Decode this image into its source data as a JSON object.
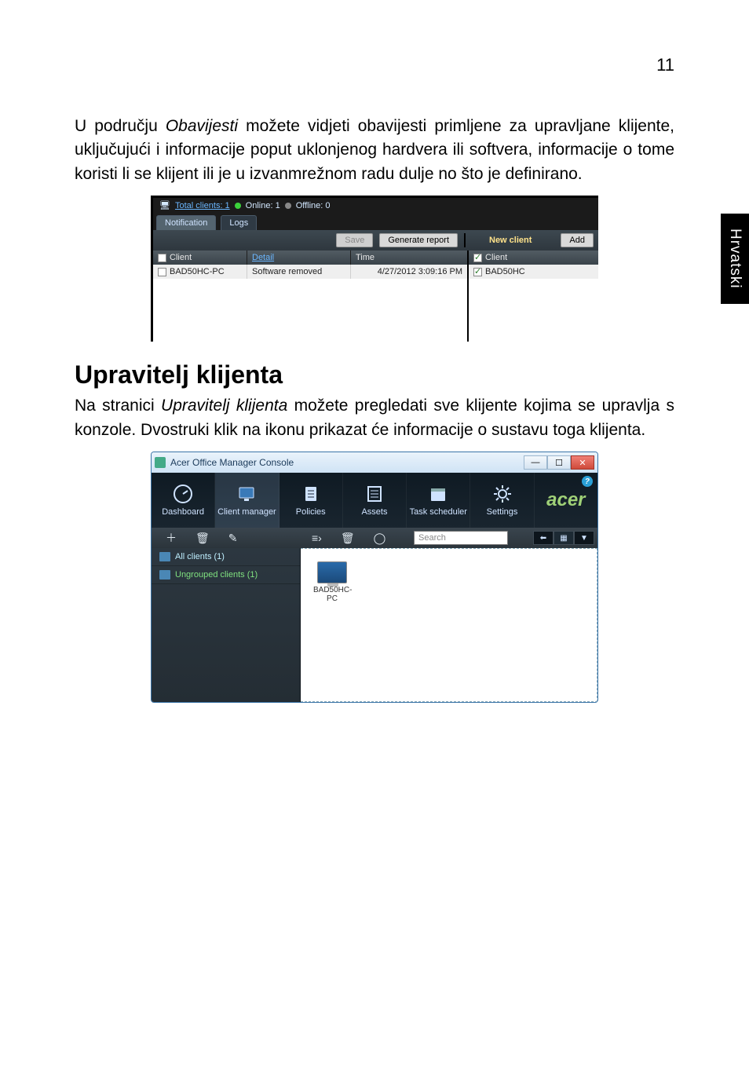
{
  "page_number": "11",
  "side_tab": "Hrvatski",
  "para1_before_italic": "U području ",
  "para1_italic": "Obavijesti",
  "para1_after_italic": " možete vidjeti obavijesti primljene za upravljane klijente, uključujući i informacije poput uklonjenog hardvera ili softvera, informacije o tome koristi li se klijent ili je u izvanmrežnom radu dulje no što je definirano.",
  "heading": "Upravitelj klijenta",
  "para2_before_italic": "Na stranici ",
  "para2_italic": "Upravitelj klijenta",
  "para2_after_italic": " možete pregledati sve klijente kojima se upravlja s konzole. Dvostruki klik na ikonu prikazat će informacije o sustavu toga klijenta.",
  "shot1": {
    "total_clients": "Total clients: 1",
    "online": "Online: 1",
    "offline": "Offline: 0",
    "tab_notification": "Notification",
    "tab_logs": "Logs",
    "btn_save": "Save",
    "btn_generate": "Generate report",
    "new_client": "New client",
    "btn_add": "Add",
    "hdr_client": "Client",
    "hdr_detail": "Detail",
    "hdr_time": "Time",
    "hdr_client2": "Client",
    "row_client": "BAD50HC-PC",
    "row_detail": "Software removed",
    "row_time": "4/27/2012 3:09:16 PM",
    "row_client2": "BAD50HC"
  },
  "shot2": {
    "title": "Acer Office Manager Console",
    "brand": "acer",
    "nav": {
      "dashboard": "Dashboard",
      "client_manager": "Client manager",
      "policies": "Policies",
      "assets": "Assets",
      "task_scheduler": "Task scheduler",
      "settings": "Settings"
    },
    "search_placeholder": "Search",
    "side_all": "All clients (1)",
    "side_ungrouped": "Ungrouped clients (1)",
    "client_label": "BAD50HC-PC"
  }
}
